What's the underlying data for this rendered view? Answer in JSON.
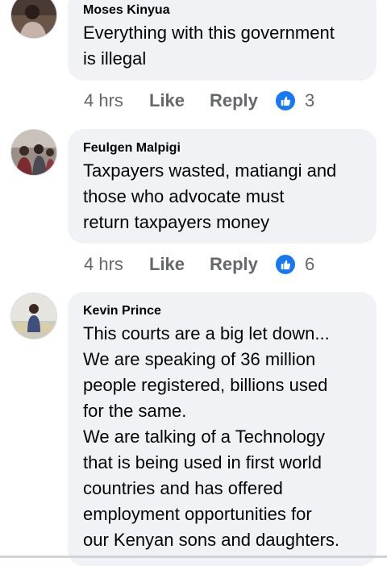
{
  "comments": [
    {
      "author": "Moses Kinyua",
      "text_lines": [
        "Everything with this government",
        "is illegal"
      ],
      "time": "4 hrs",
      "like_label": "Like",
      "reply_label": "Reply",
      "reaction_count": "3"
    },
    {
      "author": "Feulgen Malpigi",
      "text_lines": [
        "Taxpayers wasted, matiangi and",
        "those who advocate must",
        "return taxpayers money"
      ],
      "time": "4 hrs",
      "like_label": "Like",
      "reply_label": "Reply",
      "reaction_count": "6"
    },
    {
      "author": "Kevin Prince",
      "text_lines": [
        "This courts are a big let down...",
        "We are speaking of 36 million",
        "people registered, billions used",
        "for the same.",
        "We are talking of a Technology",
        "that is being used in first world",
        "countries and has offered",
        "employment opportunities for",
        "our Kenyan sons and daughters."
      ]
    }
  ],
  "colors": {
    "bubble": "#f0f2f5",
    "meta_text": "#65676b",
    "like_reaction": "#1877f2"
  },
  "icons": {
    "reaction": "thumbs-up-icon"
  }
}
